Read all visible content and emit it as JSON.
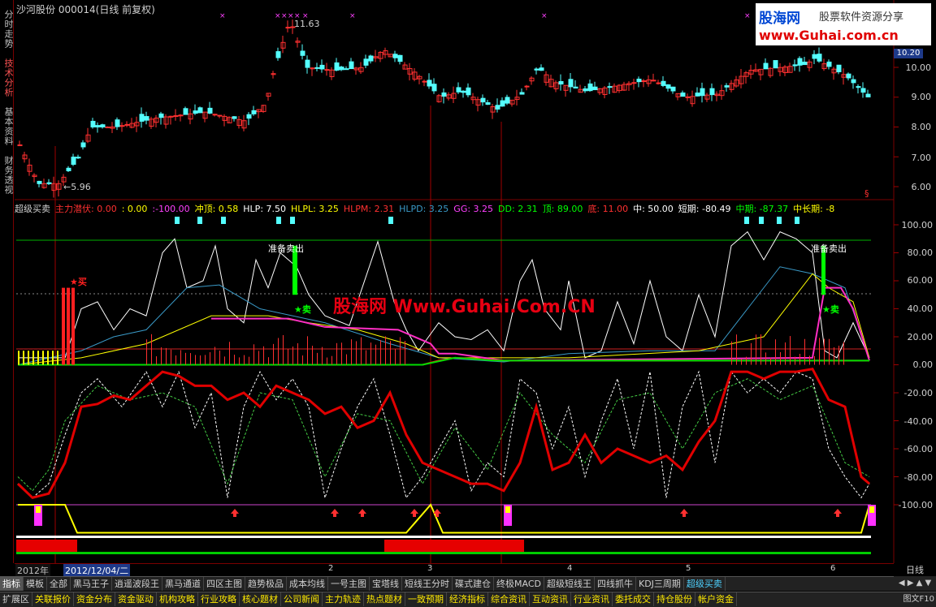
{
  "left_tabs": [
    "分时走势",
    "技术分析",
    "基本资料",
    "财务透视"
  ],
  "chart_title": {
    "stock": "沙河股份",
    "code": "000014",
    "mode": "(日线 前复权)"
  },
  "price_axis": [
    "10.00",
    "9.00",
    "8.00",
    "7.00",
    "6.00"
  ],
  "current_price": "10.20",
  "high_label": "11.63",
  "low_label": "←5.96",
  "banner": {
    "name": "股海网",
    "slogan": "股票软件资源分享",
    "url": "www.Guhai.com.cn"
  },
  "indicator_header": [
    {
      "text": "超级买卖",
      "color": "#d0d0d0"
    },
    {
      "text": "主力潜伏: 0.00",
      "color": "#ff3030"
    },
    {
      "text": ": 0.00",
      "color": "#ffff00"
    },
    {
      "text": ":-100.00",
      "color": "#ff40ff"
    },
    {
      "text": "冲顶: 0.58",
      "color": "#ffff00"
    },
    {
      "text": "HLP: 7.50",
      "color": "#ffffff"
    },
    {
      "text": "HLPL: 3.25",
      "color": "#ffff00"
    },
    {
      "text": "HLPM: 2.31",
      "color": "#ff3030"
    },
    {
      "text": "HLPD: 3.25",
      "color": "#3a9ac8"
    },
    {
      "text": "GG: 3.25",
      "color": "#ff40ff"
    },
    {
      "text": "DD: 2.31",
      "color": "#00ff00"
    },
    {
      "text": "顶: 89.00",
      "color": "#00ff00"
    },
    {
      "text": "底: 11.00",
      "color": "#ff3030"
    },
    {
      "text": "中: 50.00",
      "color": "#ffffff"
    },
    {
      "text": "短期: -80.49",
      "color": "#ffffff"
    },
    {
      "text": "中期: -87.37",
      "color": "#00ff00"
    },
    {
      "text": "中长期: -8",
      "color": "#ffff00"
    }
  ],
  "indicator_axis": [
    "100.00",
    "80.00",
    "60.00",
    "40.00",
    "20.00",
    "0.00",
    "-20.00",
    "-40.00",
    "-60.00",
    "-80.00",
    "-100.00"
  ],
  "annotations": {
    "buy": "★买",
    "sell1": "★卖",
    "sell2": "★卖",
    "ready1": "准备卖出",
    "ready2": "准备卖出",
    "s_mark": "§"
  },
  "watermark": "股海网 Www.Guhai.Com.CN",
  "dates": {
    "year": "2012年",
    "cursor": "2012/12/04/二",
    "months": [
      "2",
      "3",
      "4",
      "5",
      "6"
    ]
  },
  "period": "日线",
  "toolbar1": [
    "指标",
    "模板",
    "全部",
    "黑马王子",
    "逍遥波段王",
    "黑马通道",
    "四区主图",
    "趋势极品",
    "成本均线",
    "一号主图",
    "宝塔线",
    "短线王分时",
    "碟式建仓",
    "终极MACD",
    "超级短线王",
    "四线抓牛",
    "KDJ三周期",
    "超级买卖"
  ],
  "toolbar2": [
    "扩展区",
    "关联报价",
    "资金分布",
    "资金驱动",
    "机构攻略",
    "行业攻略",
    "核心题材",
    "公司新闻",
    "主力轨迹",
    "热点题材",
    "一致预期",
    "经济指标",
    "综合资讯",
    "互动资讯",
    "行业资讯",
    "委托成交",
    "持仓股份",
    "帐户资金"
  ],
  "status_right": "图文F10",
  "colors": {
    "up": "#ff3030",
    "down": "#54ffff",
    "grid": "#7a0000",
    "ma_white": "#ffffff",
    "ma_yellow": "#ffff00",
    "ma_magenta": "#ff40ff"
  }
}
